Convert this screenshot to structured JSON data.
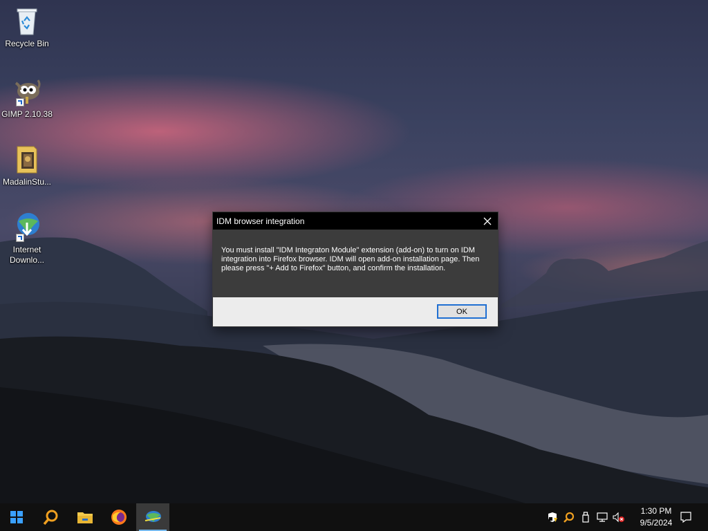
{
  "desktop": {
    "icons": [
      {
        "label": "Recycle Bin",
        "icon": "recycle-bin-icon"
      },
      {
        "label": "GIMP 2.10.38",
        "icon": "gimp-icon"
      },
      {
        "label": "MadalinStu...",
        "icon": "folder-icon"
      },
      {
        "label_line1": "Internet",
        "label_line2": "Downlo...",
        "icon": "idm-icon"
      }
    ]
  },
  "dialog": {
    "title": "IDM browser integration",
    "message": "You must install \"IDM Integraton Module\" extension (add-on) to turn on IDM integration into Firefox browser. IDM will open add-on installation page. Then please press \"+ Add to Firefox\" button, and confirm the installation.",
    "ok_label": "OK",
    "close_icon": "close-icon"
  },
  "taskbar": {
    "start_icon": "windows-start-icon",
    "pinned": [
      {
        "icon": "search-icon"
      },
      {
        "icon": "file-explorer-icon"
      },
      {
        "icon": "firefox-icon"
      },
      {
        "icon": "idm-icon",
        "active": true
      }
    ],
    "tray_icons": [
      "security-warning-icon",
      "search-tray-icon",
      "usb-device-icon",
      "network-icon",
      "volume-muted-icon"
    ],
    "time": "1:30 PM",
    "date": "9/5/2024",
    "notification_icon": "action-center-icon"
  },
  "colors": {
    "taskbar_bg": "#101010",
    "dialog_title_bg": "#000000",
    "dialog_body_bg": "#3c3c3c",
    "dialog_footer_bg": "#ececec",
    "accent": "#1f6fd2"
  }
}
